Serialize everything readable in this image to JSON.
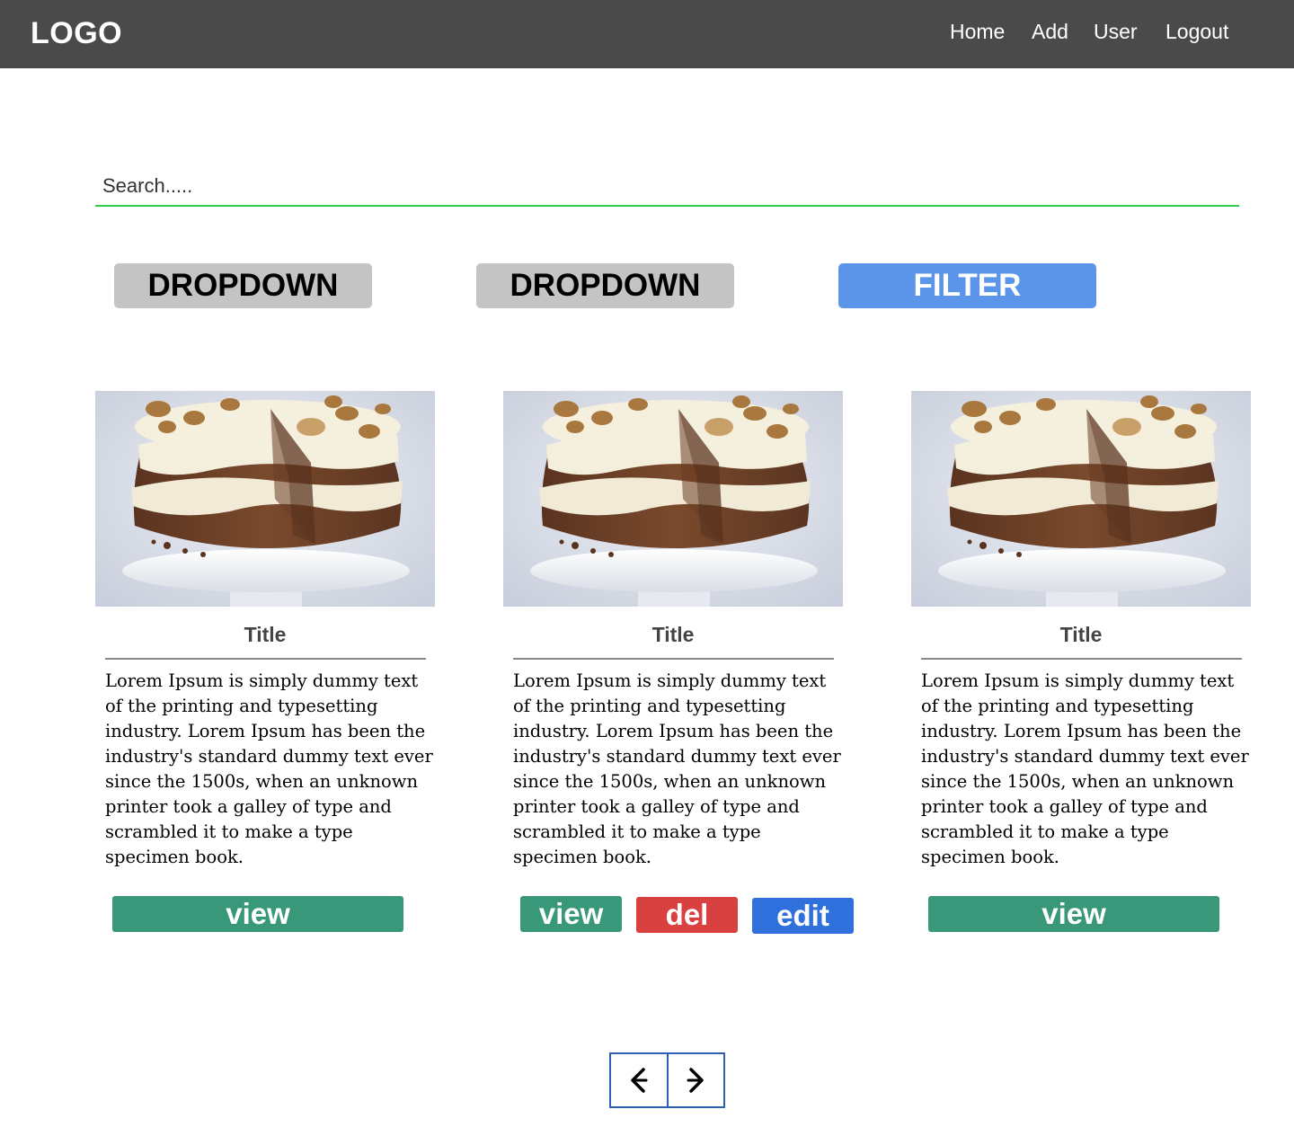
{
  "header": {
    "logo": "LOGO",
    "nav": [
      "Home",
      "Add",
      "User",
      "Logout"
    ]
  },
  "search": {
    "placeholder": "Search....."
  },
  "filters": {
    "dropdowns": [
      "DROPDOWN",
      "DROPDOWN"
    ],
    "filter_label": "FILTER"
  },
  "cards": [
    {
      "title": "Title",
      "description": "Lorem Ipsum is simply dummy text of the printing and typesetting industry. Lorem Ipsum has been the industry's standard dummy text ever since the 1500s, when an unknown printer took a galley of type and scrambled it to make a type specimen book.",
      "buttons": [
        "view"
      ]
    },
    {
      "title": "Title",
      "description": "Lorem Ipsum is simply dummy text of the printing and typesetting industry. Lorem Ipsum has been the industry's standard dummy text ever since the 1500s, when an unknown printer took a galley of type and scrambled it to make a type specimen book.",
      "buttons": [
        "view",
        "del",
        "edit"
      ]
    },
    {
      "title": "Title",
      "description": "Lorem Ipsum is simply dummy text of the printing and typesetting industry. Lorem Ipsum has been the industry's standard dummy text ever since the 1500s, when an unknown printer took a galley of type and scrambled it to make a type specimen book.",
      "buttons": [
        "view"
      ]
    }
  ],
  "pagination": {
    "prev_icon": "chevron-left-icon",
    "next_icon": "chevron-right-icon"
  },
  "colors": {
    "header_bg": "#4a4a4a",
    "search_underline": "#2ecc4f",
    "dropdown_bg": "#c4c4c4",
    "filter_bg": "#5a95e9",
    "view_bg": "#39977a",
    "del_bg": "#d94040",
    "edit_bg": "#2f70dd",
    "pager_border": "#2e5fb5"
  }
}
